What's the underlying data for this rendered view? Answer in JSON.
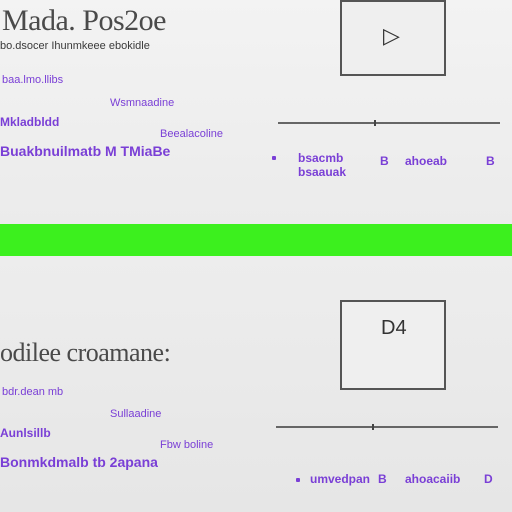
{
  "top": {
    "title": "Mada. Pos2oe",
    "subtitle": "bo.dsocer Ihunmkeee ebokidle",
    "rows": [
      "baa.lmo.llibs",
      "Wsmnaadine",
      "Mkladbldd",
      "Beealacoline",
      "Buakbnuilmatb  M  TMiaBe"
    ],
    "player": {
      "icon": "play-icon"
    },
    "controls": [
      "bsacmb",
      "bsaauak",
      "B",
      "ahoeab",
      "B"
    ]
  },
  "bottom": {
    "title": "odilee croamane:",
    "rows": [
      "bdr.dean mb",
      "Sullaadine",
      "Aunlsillb",
      "Fbw boline",
      "Bonmkdmalb  tb  2apana"
    ],
    "player": {
      "label": "D4"
    },
    "controls": [
      "umvedpan",
      "B",
      "ahoacaiib",
      "D"
    ]
  },
  "colors": {
    "accent": "#7a3fd6",
    "divider": "#3cf01e",
    "text": "#4a4a4a"
  }
}
